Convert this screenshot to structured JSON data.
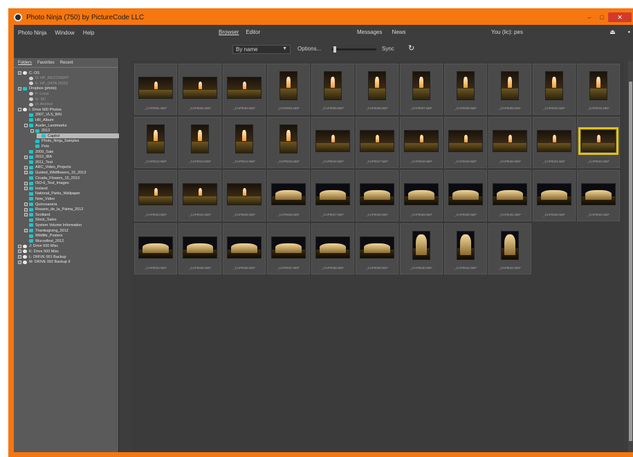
{
  "window": {
    "title": "Photo Ninja (750) by PictureCode LLC"
  },
  "menubar": {
    "menus": [
      "Photo Ninja",
      "Window",
      "Help"
    ],
    "tabs": [
      {
        "label": "Browser",
        "active": true
      },
      {
        "label": "Editor",
        "active": false
      }
    ],
    "right_links": [
      "Messages",
      "News"
    ],
    "user": "You (lic): pes"
  },
  "toolbar": {
    "sort_value": "By name",
    "options_label": "Options...",
    "sync_label": "Sync"
  },
  "sidebar": {
    "tabs": [
      {
        "label": "Folders",
        "active": true
      },
      {
        "label": "Favorites",
        "active": false
      },
      {
        "label": "Recent",
        "active": false
      }
    ]
  },
  "tree": [
    {
      "label": "C: OS",
      "depth": 0,
      "icon": "drive",
      "exp": "+"
    },
    {
      "label": "D: HP_RECOVERY",
      "depth": 1,
      "icon": "grey",
      "dim": true
    },
    {
      "label": "E: HP_DATA (SSD)",
      "depth": 1,
      "icon": "grey",
      "dim": true
    },
    {
      "label": "Dropbox (photo)",
      "depth": 0,
      "icon": "folder",
      "exp": "+"
    },
    {
      "label": "F: Local",
      "depth": 1,
      "icon": "grey",
      "dim": true
    },
    {
      "label": "G: SD",
      "depth": 1,
      "icon": "grey",
      "dim": true
    },
    {
      "label": "H: Archive",
      "depth": 1,
      "icon": "grey",
      "dim": true
    },
    {
      "label": "I: Drive 500 Photos",
      "depth": 0,
      "icon": "drive",
      "exp": "-"
    },
    {
      "label": "2007_VLS_BIN",
      "depth": 1,
      "icon": "folder"
    },
    {
      "label": "HR_Album",
      "depth": 1,
      "icon": "folder"
    },
    {
      "label": "Austin_Landmarks",
      "depth": 1,
      "icon": "folder",
      "exp": "-"
    },
    {
      "label": "2013",
      "depth": 2,
      "icon": "folder",
      "exp": "-"
    },
    {
      "label": "Capitol",
      "depth": 3,
      "icon": "folder",
      "sel": true
    },
    {
      "label": "Photo_Ninja_Samples",
      "depth": 2,
      "icon": "folder"
    },
    {
      "label": "Pets",
      "depth": 2,
      "icon": "folder"
    },
    {
      "label": "2009_Sale",
      "depth": 1,
      "icon": "folder"
    },
    {
      "label": "2010_IBA",
      "depth": 1,
      "icon": "folder",
      "exp": "+"
    },
    {
      "label": "2011_Test",
      "depth": 1,
      "icon": "folder"
    },
    {
      "label": "ARC_Video_Projects",
      "depth": 1,
      "icon": "folder",
      "exp": "+"
    },
    {
      "label": "Guided_Wildflowers_15_2013",
      "depth": 1,
      "icon": "folder",
      "exp": "+"
    },
    {
      "label": "Cicada_Flowers_15_2013",
      "depth": 1,
      "icon": "folder"
    },
    {
      "label": "ISO-6_Test_Images",
      "depth": 1,
      "icon": "folder",
      "exp": "+"
    },
    {
      "label": "Iceland",
      "depth": 1,
      "icon": "folder",
      "exp": "+"
    },
    {
      "label": "National_Parks_Wallpaper",
      "depth": 1,
      "icon": "folder"
    },
    {
      "label": "New_Video",
      "depth": 1,
      "icon": "folder"
    },
    {
      "label": "Quinceanera",
      "depth": 1,
      "icon": "folder",
      "exp": "+"
    },
    {
      "label": "Rosario_de_la_Palma_2012",
      "depth": 1,
      "icon": "folder",
      "exp": "+"
    },
    {
      "label": "Scotland",
      "depth": 1,
      "icon": "folder",
      "exp": "+"
    },
    {
      "label": "Stock_Sales",
      "depth": 1,
      "icon": "folder"
    },
    {
      "label": "System Volume Information",
      "depth": 1,
      "icon": "folder"
    },
    {
      "label": "Thanksgiving_2012",
      "depth": 1,
      "icon": "folder",
      "exp": "+"
    },
    {
      "label": "Wildlife_Posters",
      "depth": 1,
      "icon": "folder"
    },
    {
      "label": "Wurzelfest_2012",
      "depth": 1,
      "icon": "folder"
    },
    {
      "label": "J: Drive 500 Misc",
      "depth": 0,
      "icon": "drive",
      "exp": "+"
    },
    {
      "label": "K: Drive 500 Misc",
      "depth": 0,
      "icon": "drive",
      "exp": "+"
    },
    {
      "label": "L: DRIVE 001 Backup",
      "depth": 0,
      "icon": "drive",
      "exp": "+"
    },
    {
      "label": "M: DRIVE 002 Backup II",
      "depth": 0,
      "icon": "drive",
      "exp": "+"
    }
  ],
  "thumbnails": [
    {
      "kind": "land",
      "scene": "flame",
      "caption": "_CAP0001.NEF"
    },
    {
      "kind": "land",
      "scene": "flame",
      "caption": "_CAP0002.NEF"
    },
    {
      "kind": "land",
      "scene": "flame",
      "caption": "_CAP0003.NEF"
    },
    {
      "kind": "port",
      "scene": "flame",
      "caption": "_CAP0004.NEF"
    },
    {
      "kind": "port",
      "scene": "flame",
      "caption": "_CAP0005.NEF"
    },
    {
      "kind": "port",
      "scene": "flame",
      "caption": "_CAP0006.NEF"
    },
    {
      "kind": "port",
      "scene": "flame",
      "caption": "_CAP0007.NEF"
    },
    {
      "kind": "port",
      "scene": "flame",
      "caption": "_CAP0008.NEF"
    },
    {
      "kind": "port",
      "scene": "flame",
      "caption": "_CAP0009.NEF"
    },
    {
      "kind": "port",
      "scene": "flame",
      "caption": "_CAP0010.NEF"
    },
    {
      "kind": "port",
      "scene": "flame",
      "caption": "_CAP0011.NEF"
    },
    {
      "kind": "port",
      "scene": "flame",
      "caption": "_CAP0012.NEF"
    },
    {
      "kind": "port",
      "scene": "flame",
      "caption": "_CAP0013.NEF"
    },
    {
      "kind": "port",
      "scene": "flame",
      "caption": "_CAP0014.NEF"
    },
    {
      "kind": "port",
      "scene": "flame",
      "caption": "_CAP0015.NEF"
    },
    {
      "kind": "land",
      "scene": "flame",
      "caption": "_CAP0016.NEF"
    },
    {
      "kind": "land",
      "scene": "flame",
      "caption": "_CAP0017.NEF"
    },
    {
      "kind": "land",
      "scene": "flame",
      "caption": "_CAP0018.NEF"
    },
    {
      "kind": "land",
      "scene": "flame",
      "caption": "_CAP0019.NEF"
    },
    {
      "kind": "land",
      "scene": "flame",
      "caption": "_CAP0020.NEF"
    },
    {
      "kind": "land",
      "scene": "flame",
      "caption": "_CAP0021.NEF"
    },
    {
      "kind": "land",
      "scene": "flame",
      "caption": "_CAP0022.NEF",
      "selected": true
    },
    {
      "kind": "land",
      "scene": "flame",
      "caption": "_CAP0023.NEF"
    },
    {
      "kind": "land",
      "scene": "flame",
      "caption": "_CAP0024.NEF"
    },
    {
      "kind": "land",
      "scene": "flame",
      "caption": "_CAP0025.NEF"
    },
    {
      "kind": "land",
      "scene": "dome",
      "caption": "_CAP0026.NEF"
    },
    {
      "kind": "land",
      "scene": "dome",
      "caption": "_CAP0027.NEF"
    },
    {
      "kind": "land",
      "scene": "dome",
      "caption": "_CAP0028.NEF"
    },
    {
      "kind": "land",
      "scene": "dome",
      "caption": "_CAP0029.NEF"
    },
    {
      "kind": "land",
      "scene": "dome",
      "caption": "_CAP0030.NEF"
    },
    {
      "kind": "land",
      "scene": "dome",
      "caption": "_CAP0031.NEF"
    },
    {
      "kind": "land",
      "scene": "dome",
      "caption": "_CAP0032.NEF"
    },
    {
      "kind": "land",
      "scene": "dome",
      "caption": "_CAP0033.NEF"
    },
    {
      "kind": "land",
      "scene": "dome",
      "caption": "_CAP0034.NEF"
    },
    {
      "kind": "land",
      "scene": "dome",
      "caption": "_CAP0035.NEF"
    },
    {
      "kind": "land",
      "scene": "dome",
      "caption": "_CAP0036.NEF"
    },
    {
      "kind": "land",
      "scene": "dome",
      "caption": "_CAP0037.NEF"
    },
    {
      "kind": "land",
      "scene": "dome",
      "caption": "_CAP0038.NEF"
    },
    {
      "kind": "land",
      "scene": "dome",
      "caption": "_CAP0039.NEF"
    },
    {
      "kind": "port",
      "scene": "dome",
      "caption": "_CAP0040.NEF"
    },
    {
      "kind": "port",
      "scene": "dome",
      "caption": "_CAP0041.NEF"
    },
    {
      "kind": "port",
      "scene": "dome",
      "caption": "_CAP0042.NEF"
    }
  ],
  "colors": {
    "frame": "#f6760f",
    "panel": "#3b3b3b",
    "selection": "#e3c20e",
    "folder": "#22c3c9"
  }
}
